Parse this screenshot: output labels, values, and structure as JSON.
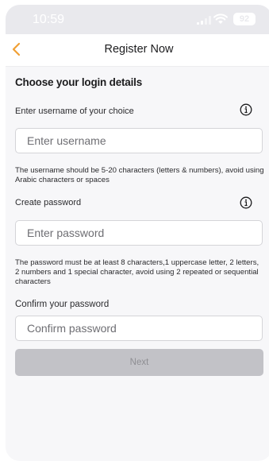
{
  "status_bar": {
    "time": "10:59",
    "battery": "92",
    "icons": [
      "signal-icon",
      "wifi-icon",
      "battery-icon"
    ]
  },
  "nav": {
    "back_icon": "chevron-left-icon",
    "title": "Register Now",
    "accent_color": "#f0a035"
  },
  "form": {
    "section_title": "Choose your login details",
    "username": {
      "label": "Enter username of your choice",
      "placeholder": "Enter username",
      "value": "",
      "info_icon": "info-icon",
      "hint": "The username should be 5-20 characters (letters & numbers), avoid using Arabic characters or spaces"
    },
    "password": {
      "label": "Create password",
      "placeholder": "Enter password",
      "value": "",
      "info_icon": "info-icon",
      "hint": "The password must be at least 8 characters,1 uppercase letter, 2 letters, 2 numbers and 1 special character, avoid using 2 repeated or sequential characters"
    },
    "confirm": {
      "label": "Confirm your password",
      "placeholder": "Confirm password",
      "value": ""
    },
    "next_label": "Next",
    "next_disabled_color": "#c2c2c7"
  }
}
